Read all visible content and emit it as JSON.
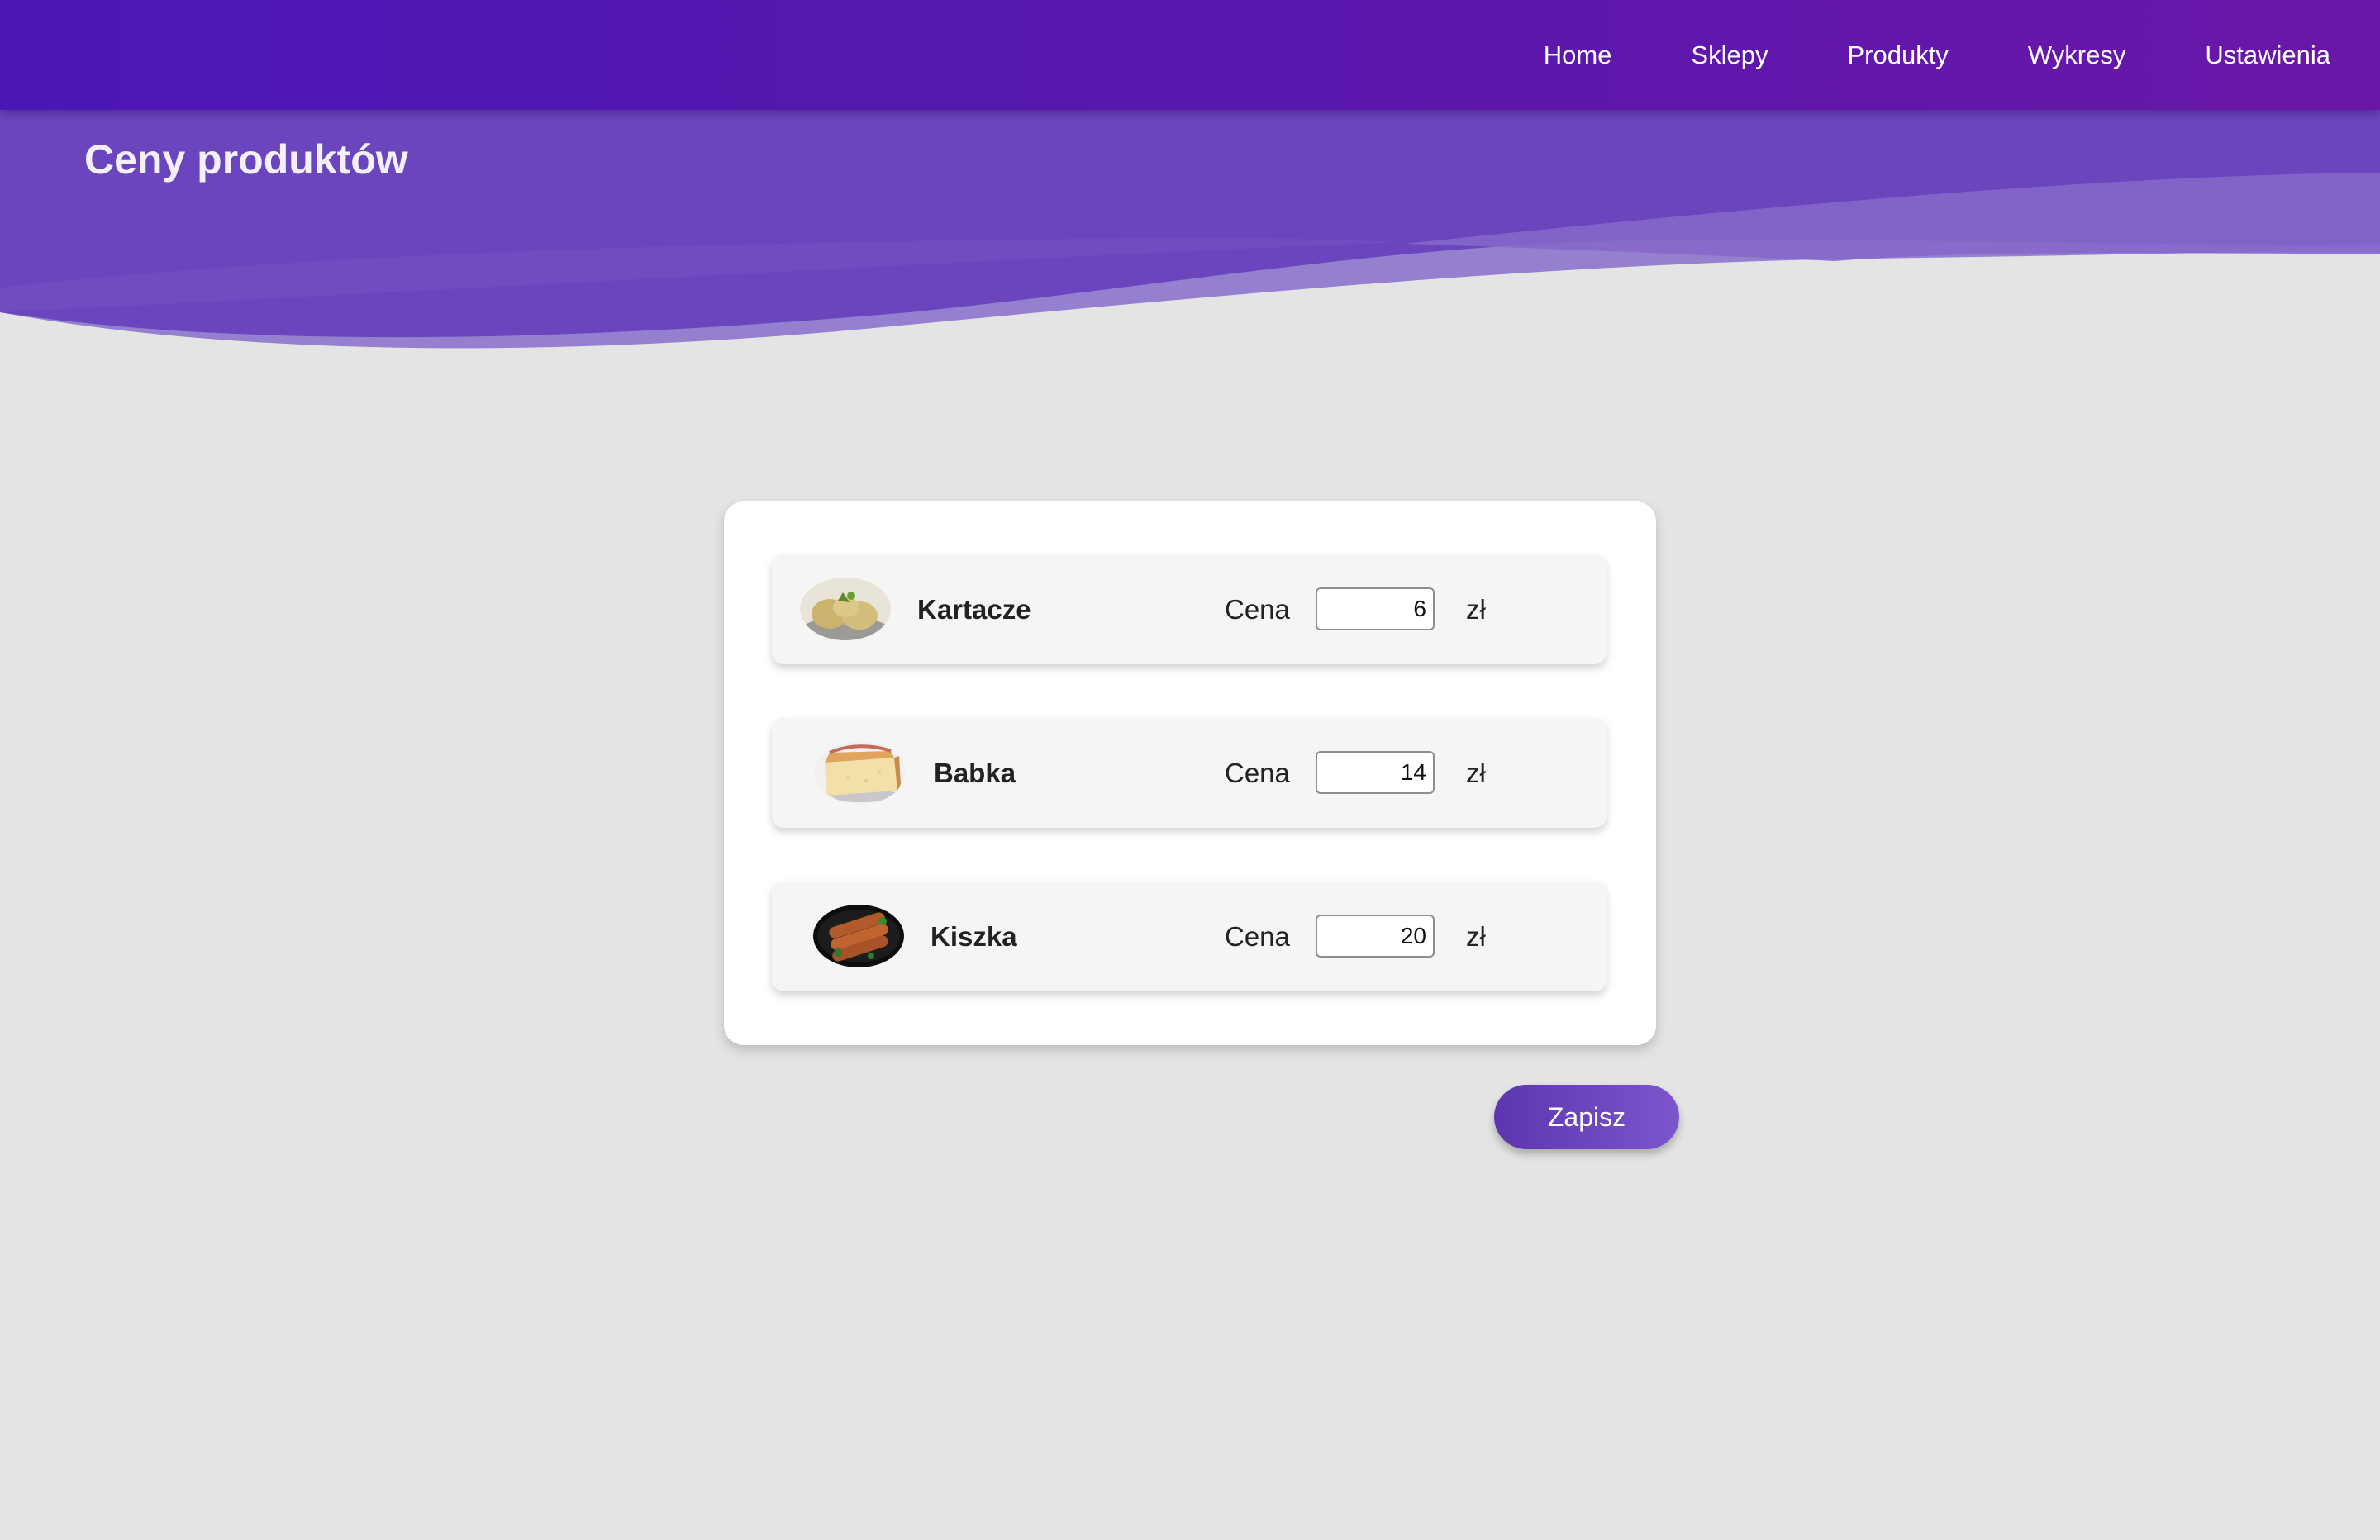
{
  "nav": {
    "items": [
      {
        "label": "Home"
      },
      {
        "label": "Sklepy"
      },
      {
        "label": "Produkty"
      },
      {
        "label": "Wykresy"
      },
      {
        "label": "Ustawienia"
      }
    ]
  },
  "page": {
    "title": "Ceny produktów"
  },
  "products": [
    {
      "name": "Kartacze",
      "price_label": "Cena",
      "price": "6",
      "unit": "zł",
      "image": "kartacze-photo"
    },
    {
      "name": "Babka",
      "price_label": "Cena",
      "price": "14",
      "unit": "zł",
      "image": "babka-photo"
    },
    {
      "name": "Kiszka",
      "price_label": "Cena",
      "price": "20",
      "unit": "zł",
      "image": "kiszka-photo"
    }
  ],
  "actions": {
    "save_label": "Zapisz"
  },
  "colors": {
    "nav_start": "#4a17b5",
    "nav_end": "#6a17a8",
    "hero": "#6640ba",
    "background": "#e4e4e4",
    "button": "#6a45be"
  }
}
